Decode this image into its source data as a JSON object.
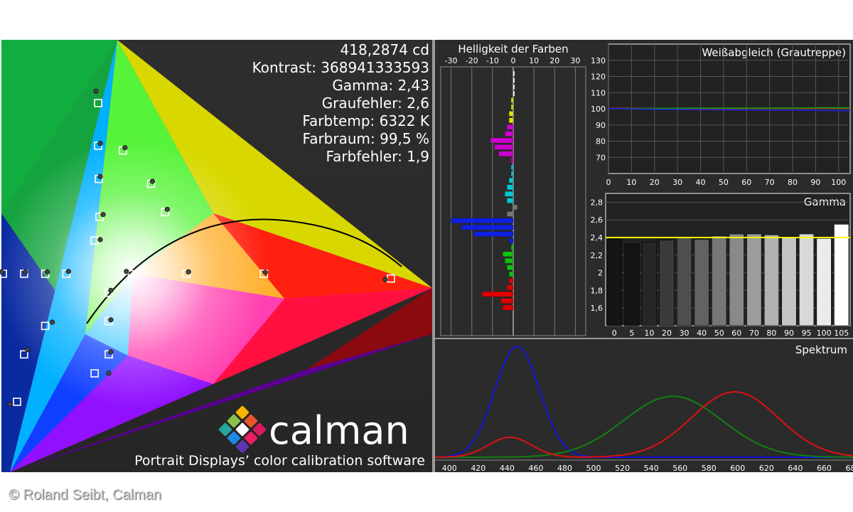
{
  "stats": [
    "418,2874 cd",
    "Kontrast: 368941333593",
    "Gamma: 2,43",
    "Graufehler: 2,6",
    "Farbtemp: 6322 K",
    "Farbraum: 99,5 %",
    "Farbfehler: 1,9"
  ],
  "brand": {
    "name": "calman",
    "tagline": "Portrait Displays’ color calibration software"
  },
  "credit": "© Roland Seibt, Calman",
  "colors": {
    "panel_bg": "#2b2b2b",
    "page_bg": "#ffffff",
    "target_line": "#ffff00",
    "red": "#e01010",
    "green": "#128012",
    "blue": "#1010dd"
  },
  "chart_data": [
    {
      "type": "scatter",
      "title": "",
      "xlim": [
        0,
        0.8
      ],
      "ylim": [
        0,
        0.9
      ],
      "gamut_triangle": [
        [
          0.68,
          0.32
        ],
        [
          0.265,
          0.69
        ],
        [
          0.15,
          0.06
        ]
      ],
      "targets": [
        [
          0.68,
          0.32
        ],
        [
          0.265,
          0.69
        ],
        [
          0.15,
          0.06
        ],
        [
          0.3127,
          0.329
        ],
        [
          0.5,
          0.33
        ],
        [
          0.39,
          0.33
        ],
        [
          0.36,
          0.46
        ],
        [
          0.34,
          0.52
        ],
        [
          0.3,
          0.59
        ],
        [
          0.265,
          0.6
        ],
        [
          0.266,
          0.53
        ],
        [
          0.267,
          0.45
        ],
        [
          0.26,
          0.4
        ],
        [
          0.22,
          0.33
        ],
        [
          0.19,
          0.33
        ],
        [
          0.16,
          0.33
        ],
        [
          0.13,
          0.33
        ],
        [
          0.19,
          0.22
        ],
        [
          0.16,
          0.16
        ],
        [
          0.28,
          0.29
        ],
        [
          0.28,
          0.23
        ],
        [
          0.28,
          0.16
        ],
        [
          0.26,
          0.12
        ]
      ],
      "measured": [
        [
          0.672,
          0.318
        ],
        [
          0.262,
          0.715
        ],
        [
          0.14,
          0.055
        ],
        [
          0.305,
          0.335
        ],
        [
          0.502,
          0.333
        ],
        [
          0.393,
          0.334
        ],
        [
          0.363,
          0.466
        ],
        [
          0.342,
          0.525
        ],
        [
          0.303,
          0.596
        ],
        [
          0.268,
          0.605
        ],
        [
          0.268,
          0.535
        ],
        [
          0.272,
          0.455
        ],
        [
          0.268,
          0.402
        ],
        [
          0.223,
          0.335
        ],
        [
          0.193,
          0.334
        ],
        [
          0.162,
          0.334
        ],
        [
          0.128,
          0.334
        ],
        [
          0.2,
          0.228
        ],
        [
          0.165,
          0.17
        ],
        [
          0.283,
          0.295
        ],
        [
          0.283,
          0.233
        ],
        [
          0.283,
          0.165
        ],
        [
          0.28,
          0.12
        ]
      ],
      "planckian_locus": [
        [
          0.2,
          0.23
        ],
        [
          0.24,
          0.29
        ],
        [
          0.28,
          0.33
        ],
        [
          0.33,
          0.36
        ],
        [
          0.38,
          0.38
        ],
        [
          0.43,
          0.39
        ],
        [
          0.48,
          0.39
        ],
        [
          0.53,
          0.38
        ],
        [
          0.57,
          0.36
        ],
        [
          0.6,
          0.34
        ]
      ]
    },
    {
      "type": "bar",
      "title": "Helligkeit der Farben",
      "orientation": "horizontal",
      "xlim": [
        -35,
        35
      ],
      "xticks": [
        -30,
        -20,
        -10,
        0,
        10,
        20,
        30
      ],
      "groups": [
        "white",
        "yellow",
        "magenta",
        "cyan",
        "black",
        "blue",
        "green",
        "red"
      ],
      "series": [
        {
          "values": [
            0,
            0,
            0,
            0
          ],
          "color": "#ffffff"
        },
        {
          "values": [
            -1,
            -1,
            -2,
            -2
          ],
          "color": "#e0e000"
        },
        {
          "values": [
            -3,
            -4,
            -11,
            -9,
            -7,
            -1
          ],
          "color": "#cc00cc"
        },
        {
          "values": [
            -1,
            -1,
            -2,
            -3,
            -4,
            -3
          ],
          "color": "#00c8d8"
        },
        {
          "values": [
            2,
            -3
          ],
          "color": "#777777"
        },
        {
          "values": [
            -30,
            -25,
            -19,
            -2
          ],
          "color": "#1020e0"
        },
        {
          "values": [
            -1,
            -5,
            -4,
            -3,
            -2
          ],
          "color": "#10c010"
        },
        {
          "values": [
            -2,
            -3,
            -15,
            -6,
            -5
          ],
          "color": "#e00000"
        }
      ]
    },
    {
      "type": "line",
      "title": "Weißabgleich (Grautreppe)",
      "xlim": [
        0,
        105
      ],
      "ylim": [
        60,
        140
      ],
      "xticks": [
        0,
        10,
        20,
        30,
        40,
        50,
        60,
        70,
        80,
        90,
        100
      ],
      "yticks": [
        70,
        80,
        90,
        100,
        110,
        120,
        130
      ],
      "x": [
        0,
        10,
        20,
        30,
        40,
        50,
        60,
        70,
        80,
        90,
        100,
        105
      ],
      "series": [
        {
          "values": [
            100.5,
            100.3,
            100.2,
            100.1,
            100.1,
            100.2,
            100.2,
            100.2,
            100.3,
            100.3,
            100.4,
            100.4
          ],
          "color": "#e01010"
        },
        {
          "values": [
            100.2,
            100.2,
            100.2,
            100.3,
            100.4,
            100.4,
            100.5,
            100.5,
            100.5,
            100.6,
            100.6,
            100.6
          ],
          "color": "#10a010"
        },
        {
          "values": [
            100.3,
            99.9,
            99.7,
            99.6,
            99.5,
            99.4,
            99.3,
            99.2,
            99.1,
            99.0,
            98.9,
            98.8
          ],
          "color": "#2020e0"
        }
      ]
    },
    {
      "type": "bar",
      "title": "Gamma",
      "ylim": [
        1.4,
        2.9
      ],
      "yticks": [
        "1,6",
        "1,8",
        "2",
        "2,2",
        "2,4",
        "2,6",
        "2,8"
      ],
      "categories": [
        "0",
        "5",
        "10",
        "20",
        "30",
        "40",
        "50",
        "60",
        "70",
        "80",
        "90",
        "95",
        "100",
        "105"
      ],
      "values": [
        2.38,
        2.33,
        2.35,
        2.37,
        2.4,
        2.38,
        2.42,
        2.44,
        2.44,
        2.43,
        2.41,
        2.44,
        2.39,
        2.55
      ],
      "target": 2.4
    },
    {
      "type": "line",
      "title": "Spektrum",
      "xlim": [
        390,
        680
      ],
      "ylim": [
        0,
        1
      ],
      "xticks": [
        400,
        420,
        440,
        460,
        480,
        500,
        520,
        540,
        560,
        580,
        600,
        620,
        640,
        660,
        680
      ],
      "series": [
        {
          "color": "#1010dd",
          "peaks": [
            [
              447,
              1.0,
              15.5
            ]
          ]
        },
        {
          "color": "#128012",
          "peaks": [
            [
              555,
              0.55,
              34
            ]
          ]
        },
        {
          "color": "#e01010",
          "peaks": [
            [
              442,
              0.18,
              15
            ],
            [
              598,
              0.59,
              30
            ]
          ]
        }
      ]
    }
  ]
}
